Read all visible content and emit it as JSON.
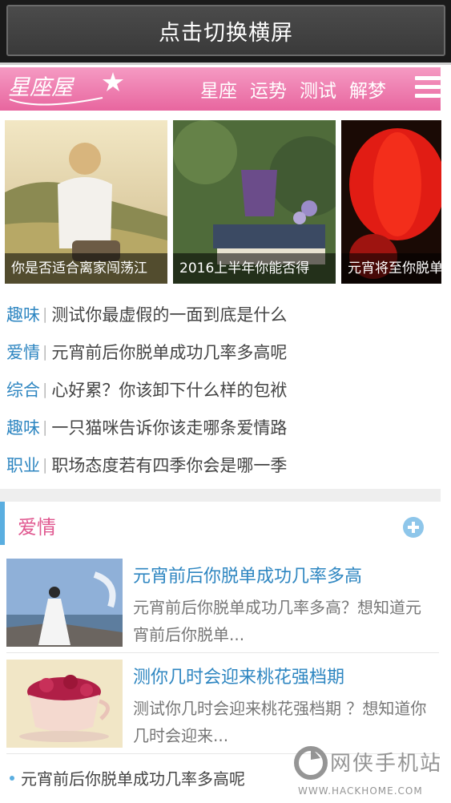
{
  "system": {
    "rotate_label": "点击切换横屏"
  },
  "header": {
    "logo_text": "星座屋",
    "nav": [
      "星座",
      "运势",
      "测试",
      "解梦"
    ],
    "menu_icon": "hamburger-menu-icon"
  },
  "carousel": {
    "slides": [
      {
        "caption": "你是否适合离家闯荡江"
      },
      {
        "caption": "2016上半年你能否得"
      },
      {
        "caption": "元宵将至你脱单"
      }
    ]
  },
  "headlines": [
    {
      "category": "趣味",
      "title": "测试你最虚假的一面到底是什么"
    },
    {
      "category": "爱情",
      "title": "元宵前后你脱单成功几率多高呢"
    },
    {
      "category": "综合",
      "title": "心好累？你该卸下什么样的包袱"
    },
    {
      "category": "趣味",
      "title": "一只猫咪告诉你该走哪条爱情路"
    },
    {
      "category": "职业",
      "title": "职场态度若有四季你会是哪一季"
    }
  ],
  "section": {
    "title": "爱情",
    "articles": [
      {
        "title": "元宵前后你脱单成功几率多高",
        "desc": "元宵前后你脱单成功几率多高？想知道元宵前后你脱单..."
      },
      {
        "title": "测你几时会迎来桃花强档期",
        "desc": "测试你几时会迎来桃花强档期 ？想知道你几时会迎来..."
      }
    ],
    "more_item": "元宵前后你脱单成功几率多高呢"
  },
  "watermark": {
    "text": "网侠手机站",
    "sub": "WWW.HACKHOME.COM"
  },
  "colors": {
    "pink": "#e8669f",
    "blue": "#2e86c1",
    "accent_blue": "#5aaee0"
  }
}
